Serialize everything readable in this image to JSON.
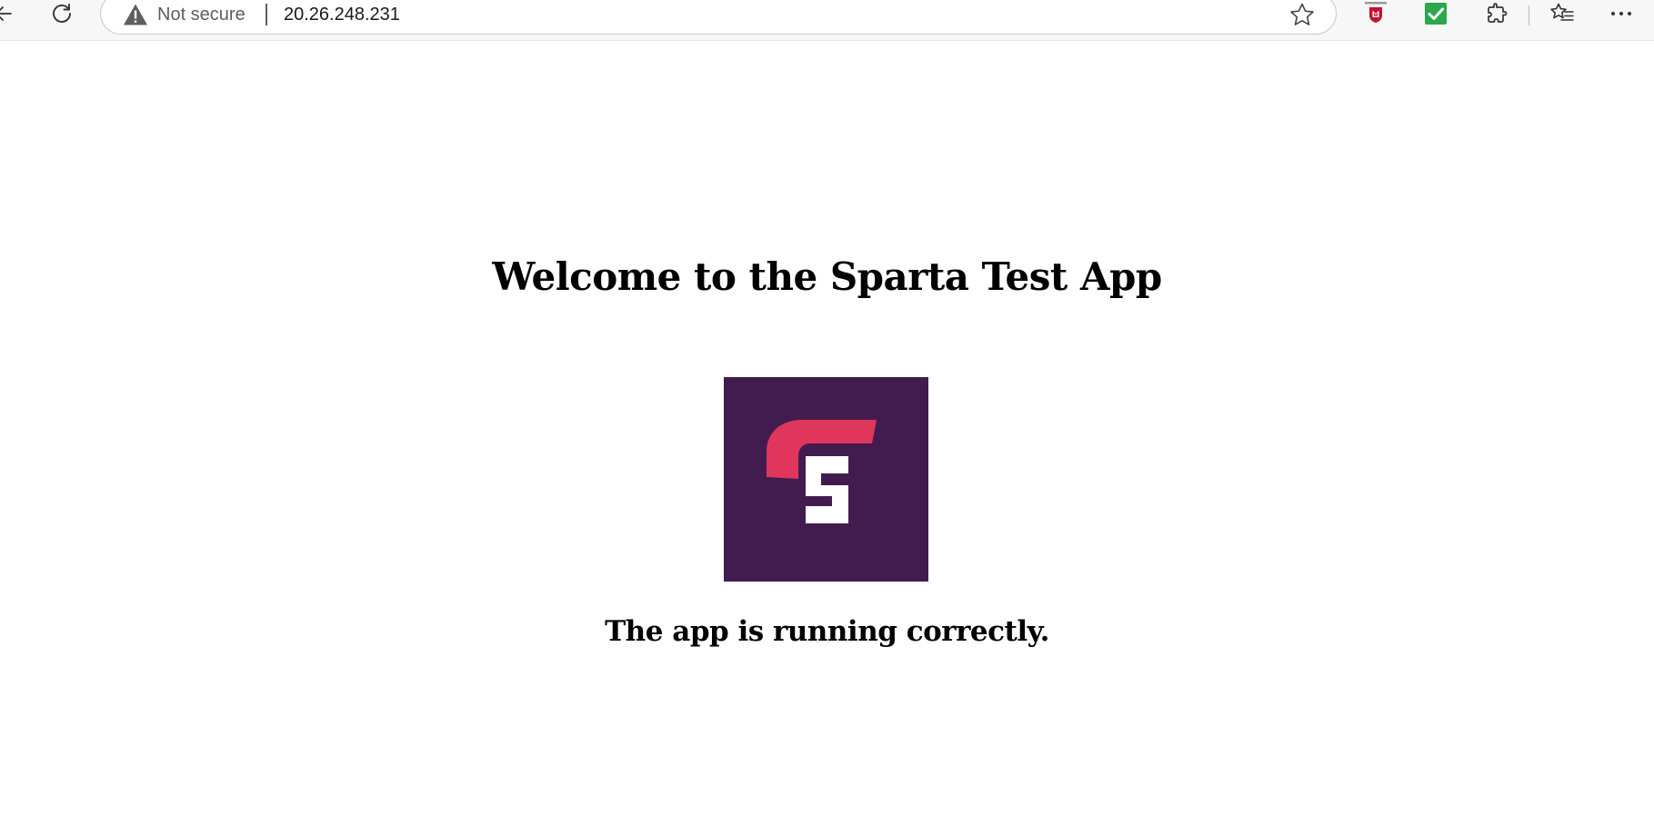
{
  "browser": {
    "security_label": "Not secure",
    "url": "20.26.248.231",
    "icons": {
      "back": "back-arrow-icon",
      "refresh": "refresh-icon",
      "warning": "warning-triangle-icon",
      "favorite": "star-outline-icon",
      "ext_shield": "security-shield-extension-icon",
      "ext_check": "green-check-extension-icon",
      "extensions": "puzzle-piece-icon",
      "favorites": "favorites-list-icon",
      "more": "more-ellipsis-icon"
    }
  },
  "page": {
    "heading": "Welcome to the Sparta Test App",
    "tagline": "The app is running correctly.",
    "logo": {
      "name": "sparta-logo",
      "letter": "S",
      "background": "#431c4f",
      "accent": "#e0365c",
      "foreground": "#ffffff"
    }
  }
}
